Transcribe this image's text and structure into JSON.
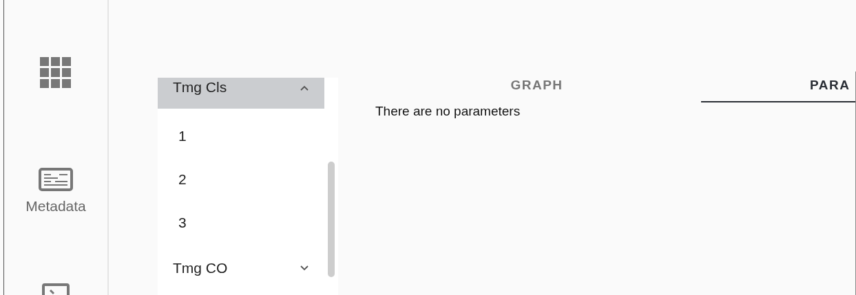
{
  "rail": [
    {
      "kind": "grid"
    },
    {
      "kind": "metadata",
      "label": "Metadata"
    },
    {
      "kind": "terminal"
    }
  ],
  "tree": [
    {
      "label": "Tmg Cls",
      "expanded": true,
      "selected": true,
      "children": [
        {
          "label": "1"
        },
        {
          "label": "2"
        },
        {
          "label": "3"
        }
      ]
    },
    {
      "label": "Tmg CO",
      "expanded": false,
      "selected": false
    }
  ],
  "tabs": [
    {
      "label": "GRAPH",
      "selected": false
    },
    {
      "label": "PARA",
      "selected": true
    }
  ],
  "message": "There are no parameters"
}
